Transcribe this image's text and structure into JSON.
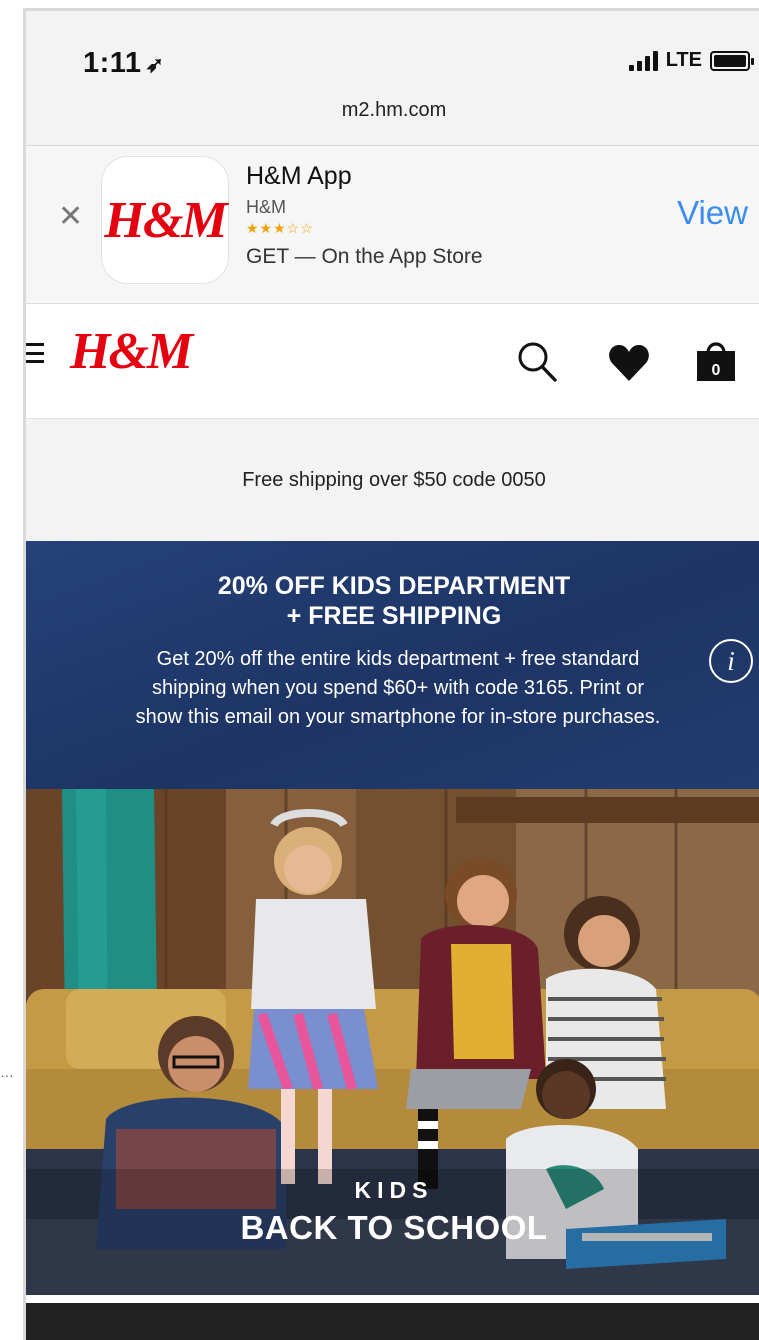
{
  "status": {
    "time": "1:11",
    "carrier": "LTE"
  },
  "browser": {
    "url": "m2.hm.com"
  },
  "app_banner": {
    "logo_text": "H&M",
    "title": "H&M App",
    "developer": "H&M",
    "stars": "★★★☆☆",
    "get_text": "GET — On the App Store",
    "view_label": "View"
  },
  "nav": {
    "logo_text": "H&M",
    "bag_count": "0"
  },
  "shipping_bar": {
    "text": "Free shipping over $50 code 0050"
  },
  "promo": {
    "title_line1": "20% OFF KIDS DEPARTMENT",
    "title_line2": "+ FREE SHIPPING",
    "body": "Get 20% off the entire kids department + free standard shipping when you spend $60+ with code 3165. Print or show this email on your smartphone for in-store purchases.",
    "info_label": "i"
  },
  "hero": {
    "subtitle": "KIDS",
    "title": "BACK TO SCHOOL"
  },
  "icons": {
    "status": [
      "location-arrow-icon",
      "signal-icon",
      "battery-icon"
    ],
    "nav": [
      "menu-icon",
      "search-icon",
      "heart-icon",
      "bag-icon"
    ],
    "banner": [
      "close-icon",
      "info-icon"
    ]
  },
  "colors": {
    "brand_red": "#e50010",
    "link_blue": "#3b8cf0",
    "promo_navy": "#21396b"
  }
}
